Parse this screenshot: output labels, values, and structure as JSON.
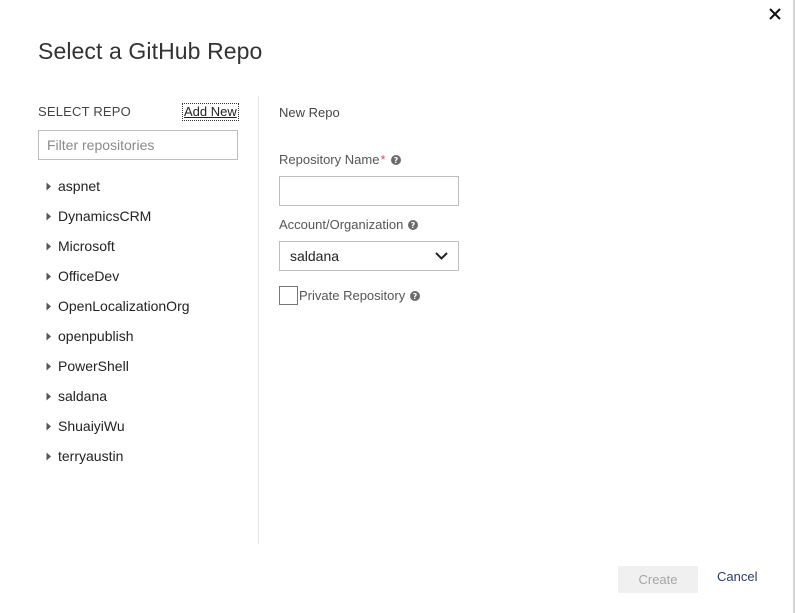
{
  "dialog": {
    "title": "Select a GitHub Repo",
    "close_icon": "close-icon"
  },
  "left": {
    "select_repo_label": "SELECT REPO",
    "add_new_label": "Add New",
    "filter_placeholder": "Filter repositories",
    "filter_value": "",
    "repos": [
      {
        "name": "aspnet",
        "icon": "caret-right-icon"
      },
      {
        "name": "DynamicsCRM",
        "icon": "caret-right-icon"
      },
      {
        "name": "Microsoft",
        "icon": "caret-right-icon"
      },
      {
        "name": "OfficeDev",
        "icon": "caret-right-icon"
      },
      {
        "name": "OpenLocalizationOrg",
        "icon": "caret-right-icon"
      },
      {
        "name": "openpublish",
        "icon": "caret-right-icon"
      },
      {
        "name": "PowerShell",
        "icon": "caret-right-icon"
      },
      {
        "name": "saldana",
        "icon": "caret-right-icon"
      },
      {
        "name": "ShuaiyiWu",
        "icon": "caret-right-icon"
      },
      {
        "name": "terryaustin",
        "icon": "caret-right-icon"
      }
    ]
  },
  "right": {
    "section_title": "New Repo",
    "repo_name_label": "Repository Name",
    "required_marker": "*",
    "repo_name_value": "",
    "account_label": "Account/Organization",
    "account_selected": "saldana",
    "private_label": "Private Repository",
    "private_checked": false,
    "help_icon": "help-icon"
  },
  "footer": {
    "create_label": "Create",
    "create_enabled": false,
    "cancel_label": "Cancel"
  },
  "colors": {
    "accent_link": "#2b3a6b",
    "required": "#d9534f",
    "disabled_button_bg": "#f0f0f0",
    "disabled_button_text": "#a6a6a6"
  }
}
